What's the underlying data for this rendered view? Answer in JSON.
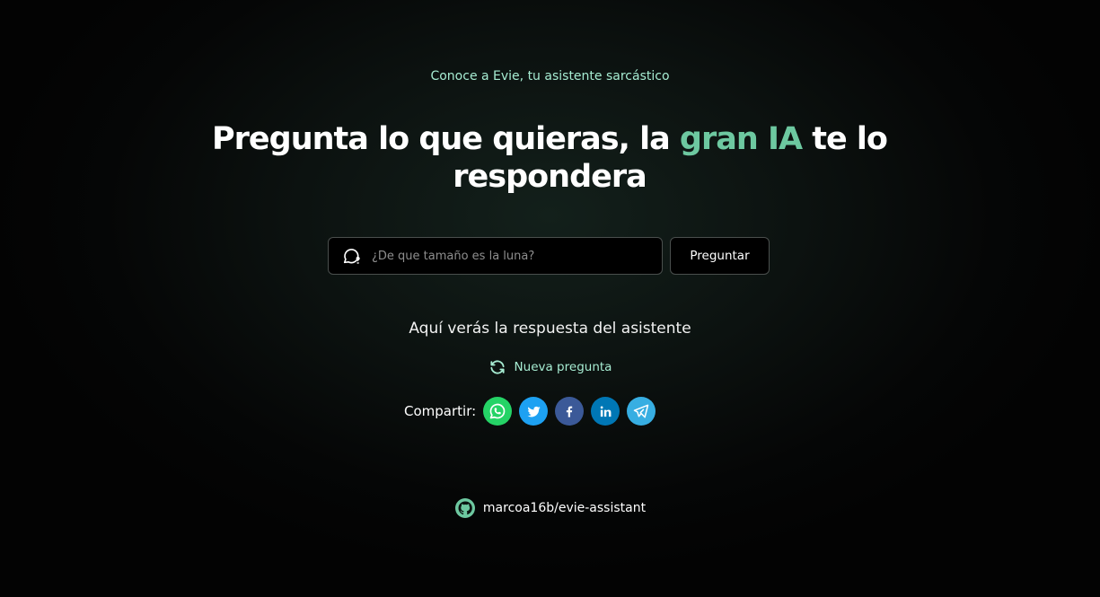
{
  "header": {
    "tagline": "Conoce a Evie, tu asistente sarcástico",
    "headline_before": "Pregunta lo que quieras, la ",
    "headline_accent": "gran IA",
    "headline_after": " te lo respondera"
  },
  "search": {
    "placeholder": "¿De que tamaño es la luna?",
    "value": "",
    "button_label": "Preguntar"
  },
  "answer": {
    "text": "Aquí verás la respuesta del asistente"
  },
  "new_question": {
    "label": "Nueva pregunta"
  },
  "share": {
    "label": "Compartir:",
    "buttons": [
      {
        "name": "whatsapp",
        "icon": "whatsapp-icon",
        "color": "#25d366"
      },
      {
        "name": "twitter",
        "icon": "twitter-icon",
        "color": "#1da1f2"
      },
      {
        "name": "facebook",
        "icon": "facebook-icon",
        "color": "#3b5998"
      },
      {
        "name": "linkedin",
        "icon": "linkedin-icon",
        "color": "#0077b5"
      },
      {
        "name": "telegram",
        "icon": "telegram-icon",
        "color": "#37aee2"
      }
    ]
  },
  "footer": {
    "repo": "marcoa16b/evie-assistant"
  },
  "colors": {
    "accent": "#6dc8a0",
    "accent_light": "#a6ecd2",
    "background": "#050606"
  }
}
